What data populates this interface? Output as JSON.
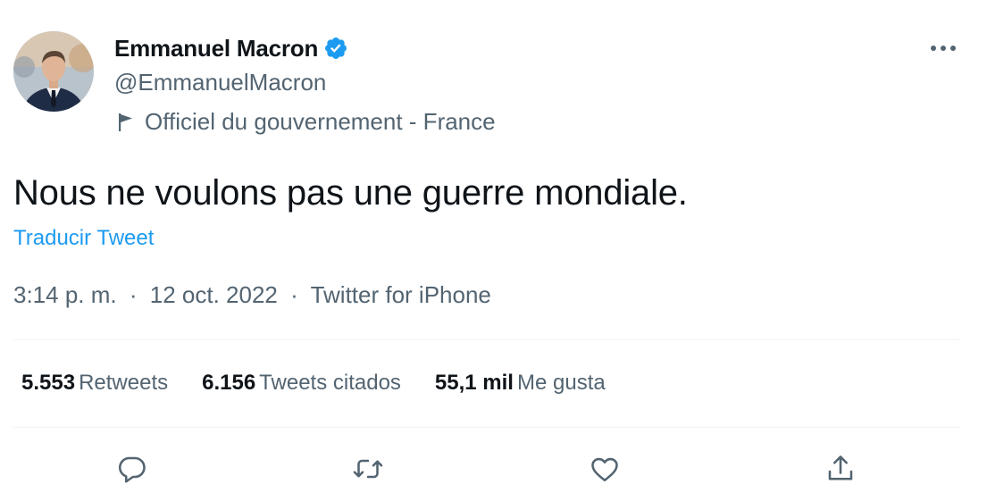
{
  "author": {
    "display_name": "Emmanuel Macron",
    "handle": "@EmmanuelMacron",
    "affiliation": "Officiel du gouvernement - France",
    "verified_icon": "verified-badge-icon"
  },
  "tweet": {
    "text": "Nous ne voulons pas une guerre mondiale.",
    "translate_label": "Traducir Tweet",
    "time": "3:14 p. m.",
    "date": "12 oct. 2022",
    "source": "Twitter for iPhone",
    "separator": "·"
  },
  "stats": [
    {
      "value": "5.553",
      "label": "Retweets"
    },
    {
      "value": "6.156",
      "label": "Tweets citados"
    },
    {
      "value": "55,1 mil",
      "label": "Me gusta"
    }
  ],
  "actions": [
    "reply-icon",
    "retweet-icon",
    "like-icon",
    "share-icon"
  ],
  "colors": {
    "primary_text": "#0f1419",
    "secondary_text": "#536471",
    "link": "#1d9bf0",
    "verified": "#1d9bf0",
    "divider": "#eff3f4"
  }
}
